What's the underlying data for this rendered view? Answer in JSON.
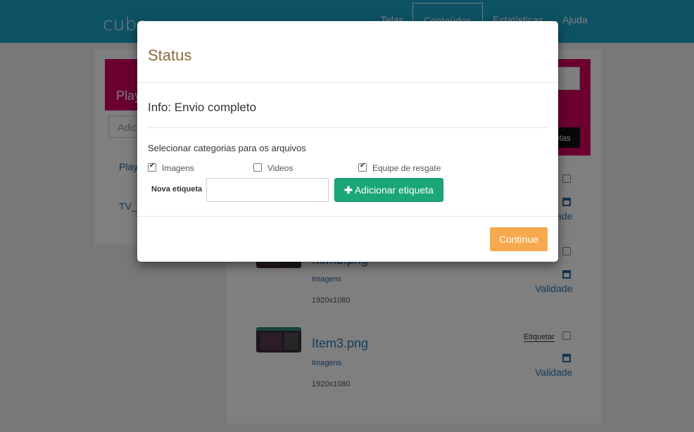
{
  "app": {
    "brand": "cubo",
    "nav": [
      "Telas",
      "Conteúdos",
      "Estatísticas",
      "Ajuda"
    ]
  },
  "left_panel": {
    "header": "Play",
    "search_placeholder": "Adic",
    "items": [
      "Play",
      "TV_"
    ]
  },
  "right_panel": {
    "button_label": "etas"
  },
  "items": [
    {
      "name": "Item2.png",
      "category": "Imagens",
      "resolution": "1920x1080",
      "validity": "Validade"
    },
    {
      "name": "Item3.png",
      "category": "Imagens",
      "resolution": "1920x1080",
      "validity": "Validade",
      "tag_label": "Etiquetar"
    }
  ],
  "first_item_validity": "Validade",
  "modal": {
    "title": "Status",
    "info": "Info: Envio completo",
    "select_label": "Selecionar categorias para os arquivos",
    "categories": [
      {
        "label": "Imagens",
        "checked": true
      },
      {
        "label": "Videos",
        "checked": false
      },
      {
        "label": "Equipe de resgate",
        "checked": true
      }
    ],
    "new_tag_label": "Nova etiqueta",
    "new_tag_value": "",
    "add_button": "Adicionar etiqueta",
    "continue_button": "Continue"
  },
  "colors": {
    "navbar": "#1aa4c8",
    "panel_header": "#d6005f",
    "add_button": "#1aa676",
    "continue_button": "#f7a94d",
    "title": "#8b6b3d"
  }
}
